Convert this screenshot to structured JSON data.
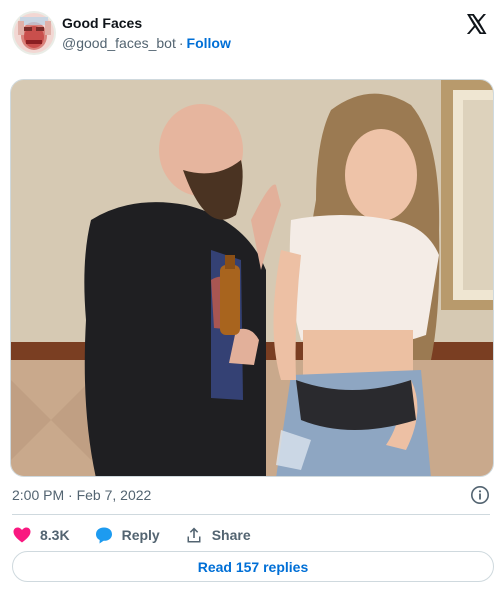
{
  "tweet": {
    "author": {
      "display_name": "Good Faces",
      "handle": "@good_faces_bot",
      "separator": "·",
      "follow_label": "Follow"
    },
    "timestamp": "2:00 PM · Feb 7, 2022",
    "actions": {
      "like_count": "8.3K",
      "reply_label": "Reply",
      "share_label": "Share"
    },
    "read_replies_label": "Read 157 replies"
  },
  "colors": {
    "link": "#006fd6",
    "like": "#f91880",
    "reply": "#1d9bf0",
    "muted": "#536471",
    "border": "#cfd9de"
  },
  "icons": {
    "brand": "x-logo-icon",
    "info": "info-icon",
    "like": "heart-icon",
    "reply": "speech-bubble-icon",
    "share": "share-upload-icon"
  }
}
